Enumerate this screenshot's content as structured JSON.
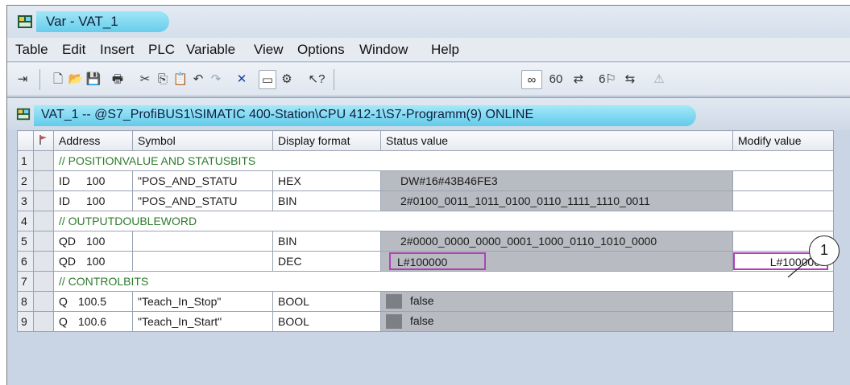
{
  "window": {
    "title": "Var - VAT_1"
  },
  "menu": [
    "Table",
    "Edit",
    "Insert",
    "PLC",
    "Variable",
    "View",
    "Options",
    "Window",
    "Help"
  ],
  "toolbar": {
    "pin": "⇥",
    "new": "🗋",
    "open": "📂",
    "save": "💾",
    "print": "🖶",
    "cut": "✂",
    "copy": "⎘",
    "paste": "📋",
    "undo": "↶",
    "redo": "↷",
    "delete": "✕",
    "online": "▭",
    "settings": "⚙",
    "help": "↖?",
    "monitor": "∞",
    "monitor_values": "60",
    "modify": "⇄",
    "trigger": "6⚐",
    "modify_trigger": "⇆",
    "force": "⚠"
  },
  "child_window": {
    "title": "VAT_1 -- @S7_ProfiBUS1\\SIMATIC 400-Station\\CPU 412-1\\S7-Programm(9)  ONLINE"
  },
  "table": {
    "headers": {
      "address": "Address",
      "symbol": "Symbol",
      "display_format": "Display format",
      "status_value": "Status value",
      "modify_value": "Modify value"
    },
    "rows": [
      {
        "n": "1",
        "comment": "// POSITIONVALUE AND STATUSBITS"
      },
      {
        "n": "2",
        "op": "ID",
        "addr": "100",
        "symbol": "\"POS_AND_STATU",
        "format": "HEX",
        "status": "DW#16#43B46FE3",
        "modify": ""
      },
      {
        "n": "3",
        "op": "ID",
        "addr": "100",
        "symbol": "\"POS_AND_STATU",
        "format": "BIN",
        "status": "2#0100_0011_1011_0100_0110_1111_1110_0011",
        "modify": ""
      },
      {
        "n": "4",
        "comment": "// OUTPUTDOUBLEWORD"
      },
      {
        "n": "5",
        "op": "QD",
        "addr": "100",
        "symbol": "",
        "format": "BIN",
        "status": "2#0000_0000_0000_0001_1000_0110_1010_0000",
        "modify": ""
      },
      {
        "n": "6",
        "op": "QD",
        "addr": "100",
        "symbol": "",
        "format": "DEC",
        "status": "L#100000",
        "modify": "L#100000"
      },
      {
        "n": "7",
        "comment": "// CONTROLBITS"
      },
      {
        "n": "8",
        "op": "Q",
        "addr": "100.5",
        "symbol": "\"Teach_In_Stop\"",
        "format": "BOOL",
        "status": "false",
        "modify": ""
      },
      {
        "n": "9",
        "op": "Q",
        "addr": "100.6",
        "symbol": "\"Teach_In_Start\"",
        "format": "BOOL",
        "status": "false",
        "modify": ""
      }
    ]
  },
  "callout": {
    "label": "1"
  },
  "colors": {
    "highlight": "#b040b8",
    "comment": "#2c7a2c",
    "status_bg": "#b8bcc2",
    "tab_cyan": "#68cdea"
  }
}
